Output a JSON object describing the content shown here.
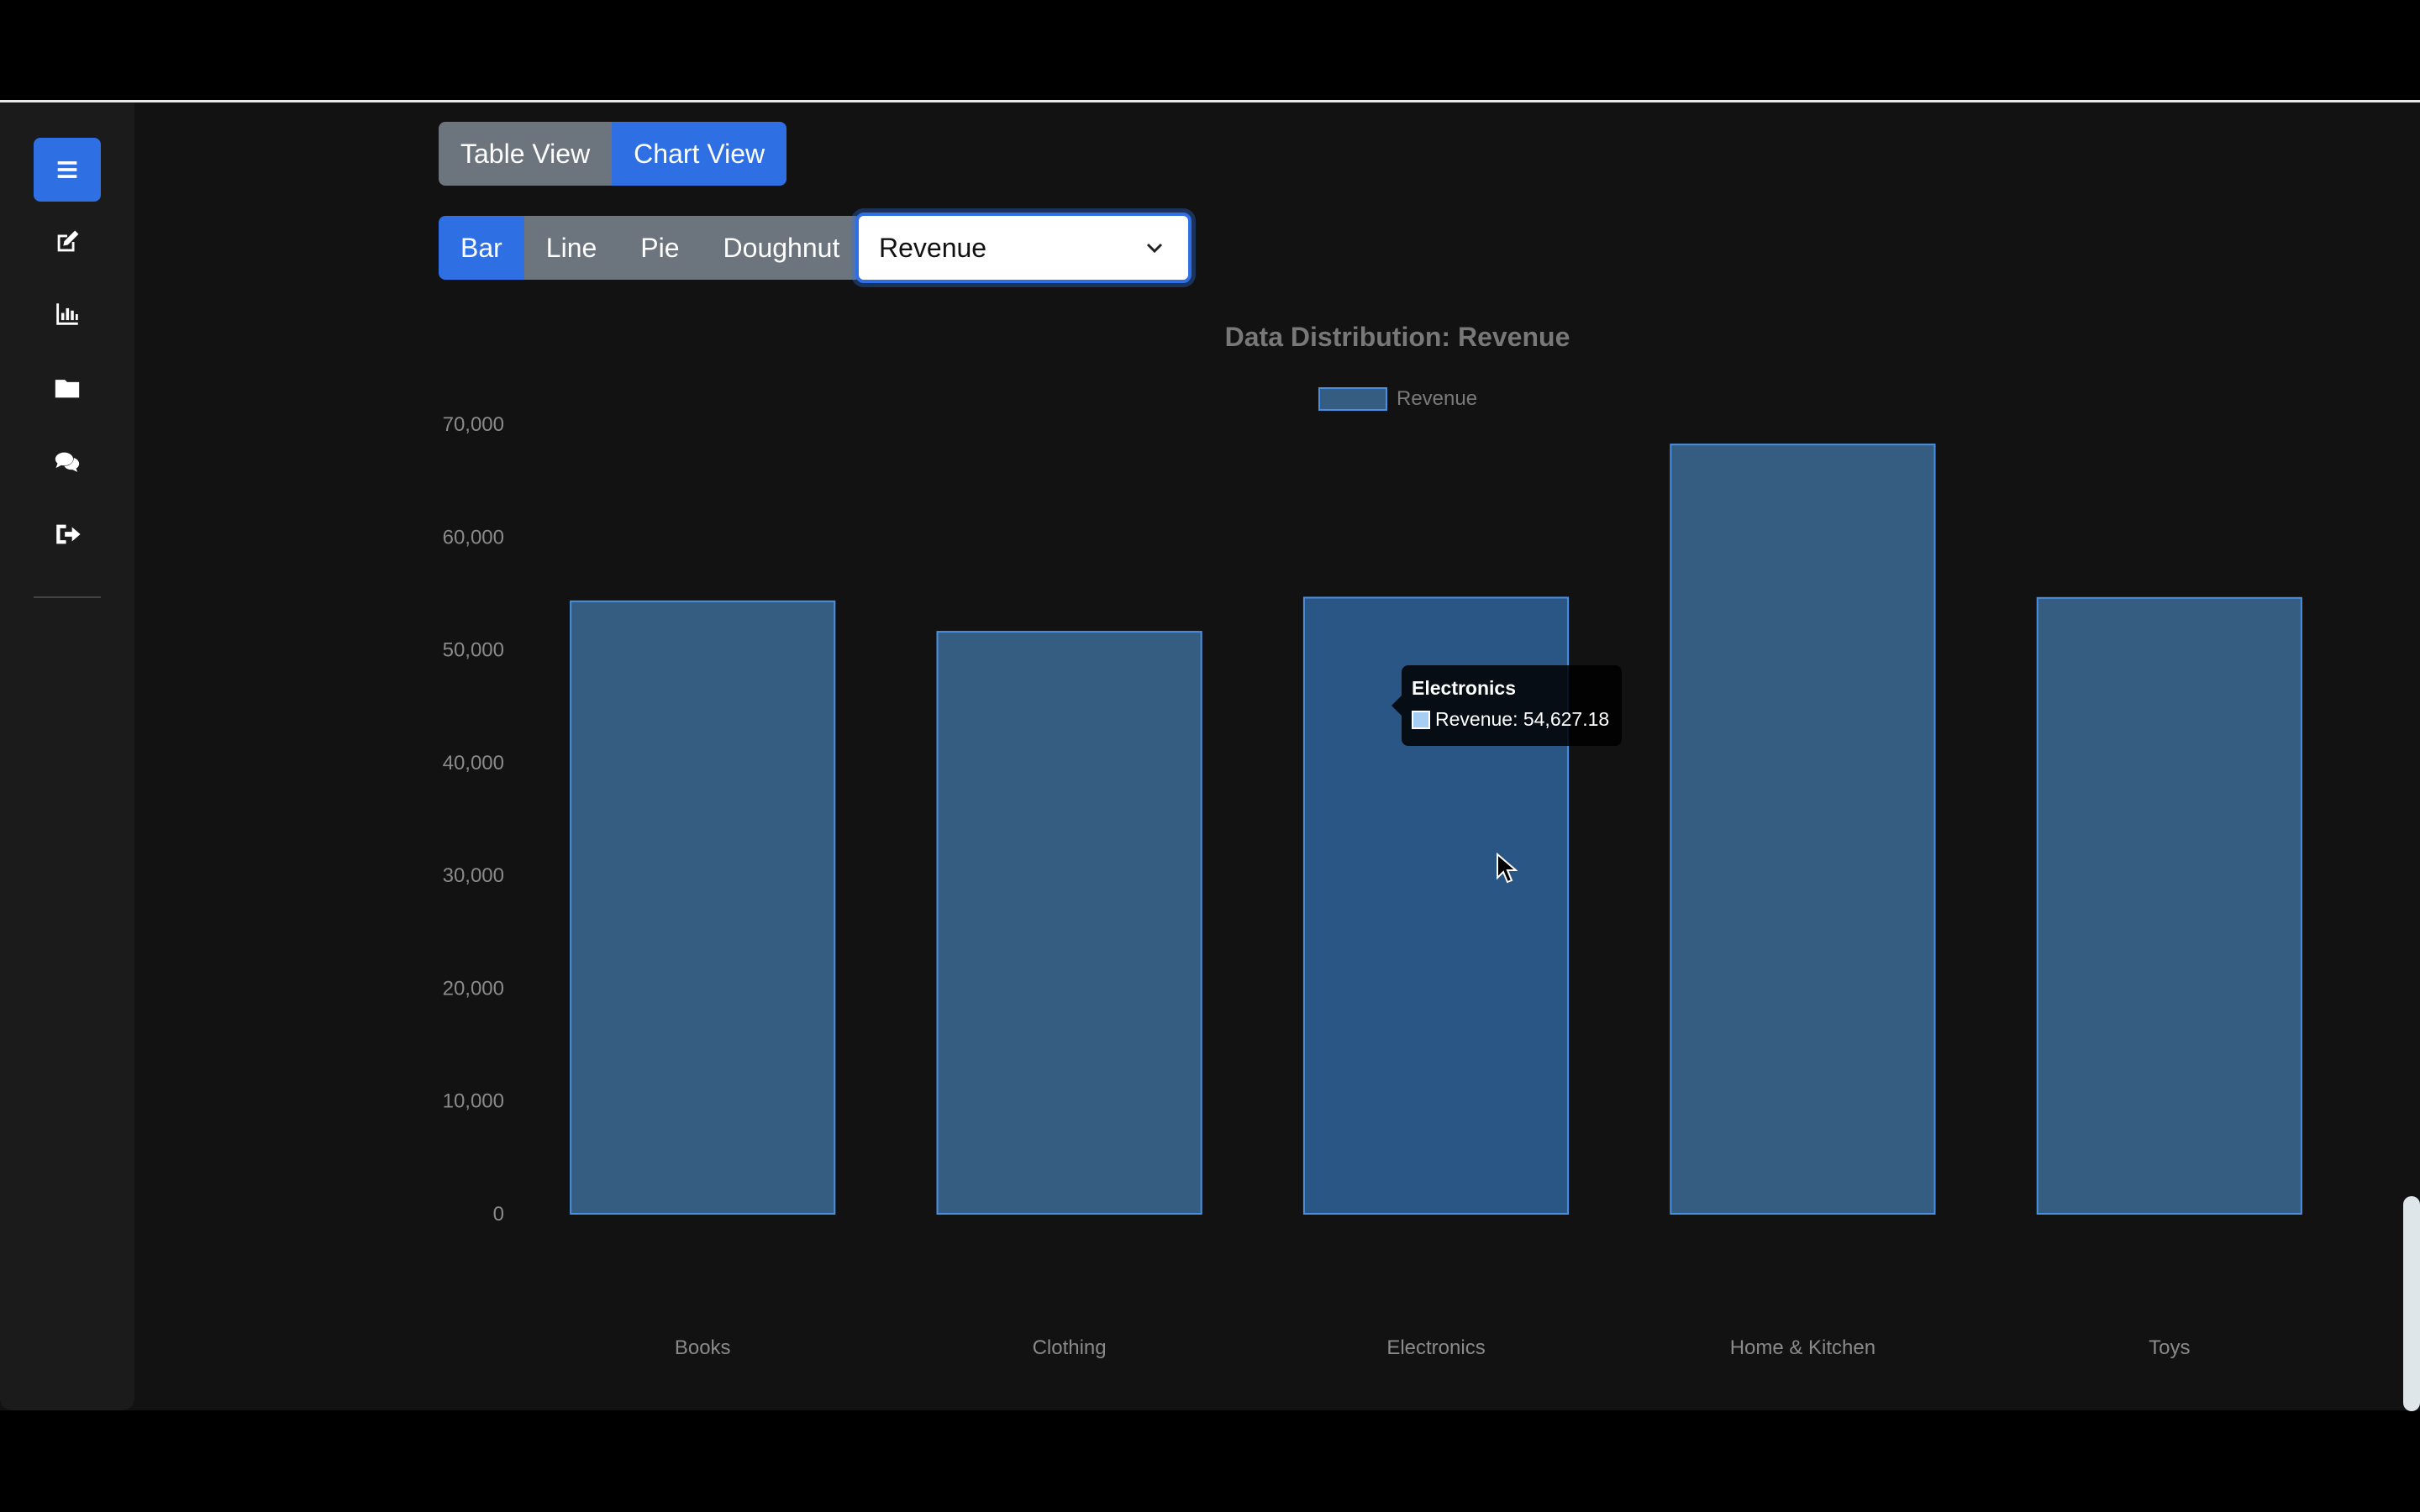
{
  "view_toggle": {
    "options": [
      "Table View",
      "Chart View"
    ],
    "active": "Chart View"
  },
  "chart_type": {
    "options": [
      "Bar",
      "Line",
      "Pie",
      "Doughnut"
    ],
    "active": "Bar"
  },
  "metric_select": {
    "value": "Revenue"
  },
  "sidebar": {
    "items": [
      {
        "icon": "menu-icon",
        "active": true
      },
      {
        "icon": "edit-icon",
        "active": false
      },
      {
        "icon": "bar-chart-icon",
        "active": false
      },
      {
        "icon": "folder-icon",
        "active": false
      },
      {
        "icon": "comments-icon",
        "active": false
      },
      {
        "icon": "sign-out-icon",
        "active": false
      }
    ]
  },
  "tooltip": {
    "title": "Electronics",
    "label": "Revenue: 54,627.18"
  },
  "colors": {
    "accent": "#2f6fe4",
    "bar_fill": "#355d82",
    "bar_border": "#4a90e2",
    "bar_hover": "#2a5686"
  },
  "chart_data": {
    "type": "bar",
    "title": "Data Distribution: Revenue",
    "categories": [
      "Books",
      "Clothing",
      "Electronics",
      "Home & Kitchen",
      "Toys"
    ],
    "series": [
      {
        "name": "Revenue",
        "values": [
          54300,
          51600,
          54627.18,
          68200,
          54600
        ]
      }
    ],
    "ylim": [
      0,
      70000
    ],
    "yticks": [
      0,
      10000,
      20000,
      30000,
      40000,
      50000,
      60000,
      70000
    ],
    "ytick_labels": [
      "0",
      "10,000",
      "20,000",
      "30,000",
      "40,000",
      "50,000",
      "60,000",
      "70,000"
    ],
    "legend": "top-center",
    "grid": false
  }
}
